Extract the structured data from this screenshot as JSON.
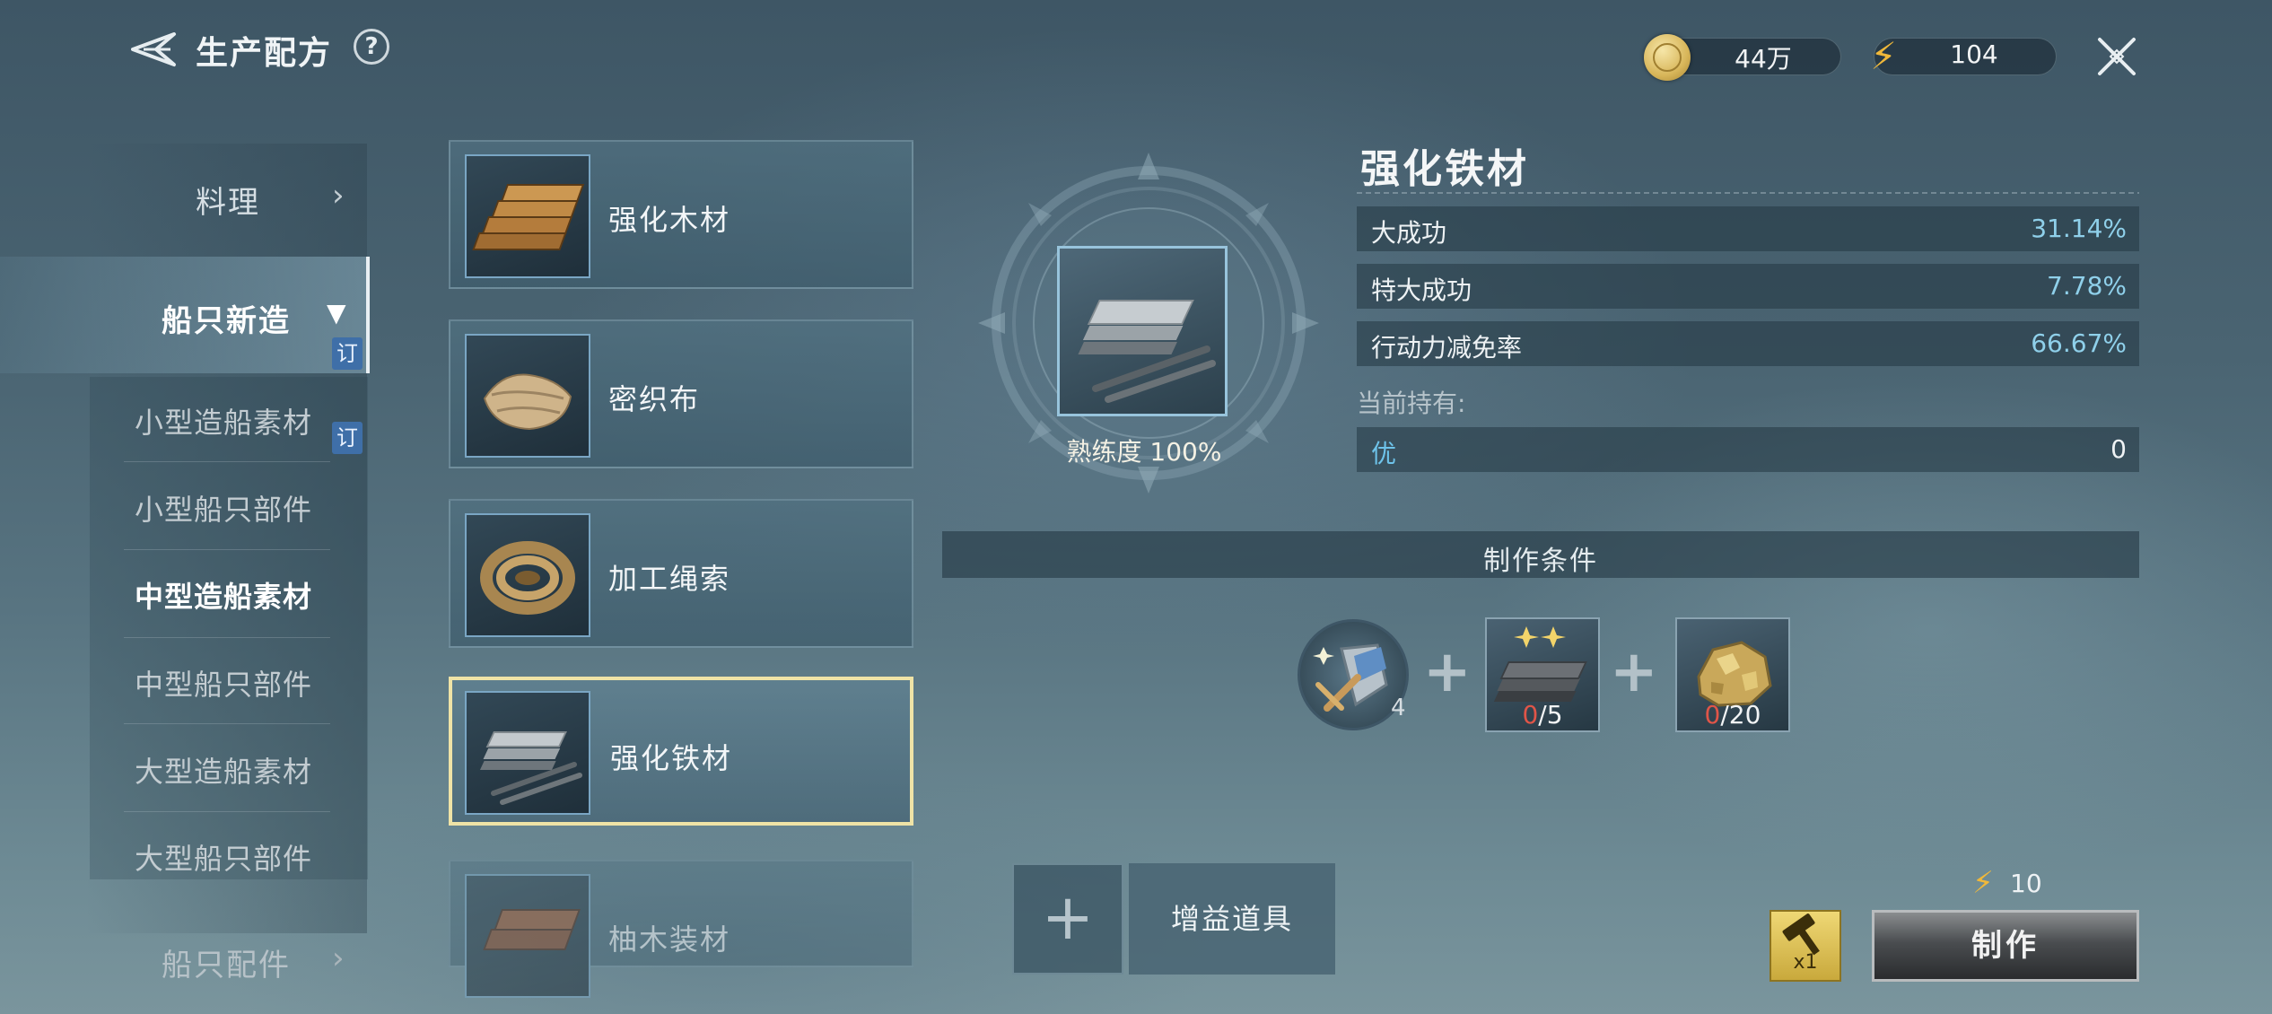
{
  "header": {
    "title": "生产配方",
    "help_label": "?",
    "gold_value": "44万",
    "energy_value": "104"
  },
  "nav": {
    "cooking": "料理",
    "ship_new": "船只新造",
    "badge": "订",
    "sub_items": [
      "小型造船素材",
      "小型船只部件",
      "中型造船素材",
      "中型船只部件",
      "大型造船素材",
      "大型船只部件"
    ],
    "active_sub": "中型造船素材",
    "fittings": "船只配件"
  },
  "recipes": [
    "强化木材",
    "密织布",
    "加工绳索",
    "强化铁材",
    "柚木装材"
  ],
  "selected_recipe": "强化铁材",
  "product": {
    "name": "强化铁材",
    "proficiency": "熟练度 100%",
    "stats": [
      {
        "label": "大成功",
        "value": "31.14%"
      },
      {
        "label": "特大成功",
        "value": "7.78%"
      },
      {
        "label": "行动力减免率",
        "value": "66.67%"
      }
    ],
    "holding_label": "当前持有:",
    "holding": {
      "label": "优",
      "value": "0"
    }
  },
  "conditions": {
    "title": "制作条件",
    "tool_count": "4",
    "materials": [
      {
        "icon": "reinforced-iron-icon",
        "have": "0",
        "need": "/5"
      },
      {
        "icon": "gold-ore-icon",
        "have": "0",
        "need": "/20"
      }
    ]
  },
  "bottom": {
    "buff_add": "+",
    "buff_label": "增益道具",
    "cost": "10",
    "qty": "x1",
    "craft_label": "制作"
  },
  "colors": {
    "accent_blue": "#8fd0ea",
    "energy": "#f0b83a",
    "missing_red": "#e05548",
    "selected_border": "#efe3a6"
  }
}
